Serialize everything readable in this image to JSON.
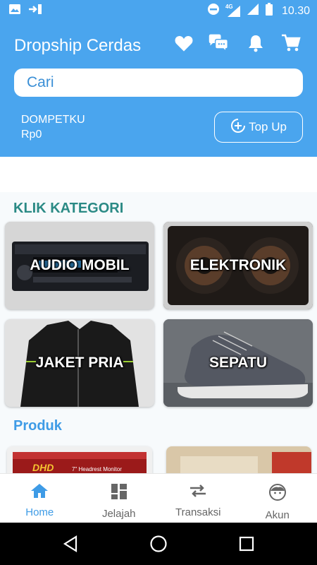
{
  "status_bar": {
    "network": "4G",
    "time": "10.30"
  },
  "header": {
    "title": "Dropship Cerdas",
    "search_placeholder": "Cari",
    "wallet_label": "DOMPETKU",
    "wallet_value": "Rp0",
    "topup_label": "Top Up",
    "icons": [
      "heart-icon",
      "chat-icon",
      "bell-icon",
      "cart-icon"
    ]
  },
  "categories": {
    "title": "KLIK KATEGORI",
    "items": [
      {
        "label": "AUDIO MOBIL"
      },
      {
        "label": "ELEKTRONIK"
      },
      {
        "label": "JAKET PRIA"
      },
      {
        "label": "SEPATU"
      }
    ]
  },
  "products": {
    "title": "Produk",
    "first_item_brand": "DHD",
    "first_item_caption": "7\" Headrest Monitor"
  },
  "bottom_nav": {
    "items": [
      {
        "label": "Home",
        "icon": "home-icon",
        "active": true
      },
      {
        "label": "Jelajah",
        "icon": "grid-icon",
        "active": false
      },
      {
        "label": "Transaksi",
        "icon": "swap-icon",
        "active": false
      },
      {
        "label": "Akun",
        "icon": "face-icon",
        "active": false
      }
    ]
  },
  "colors": {
    "primary": "#4aa5ee",
    "category_title": "#2b8a85",
    "product_title": "#3e9be6"
  }
}
